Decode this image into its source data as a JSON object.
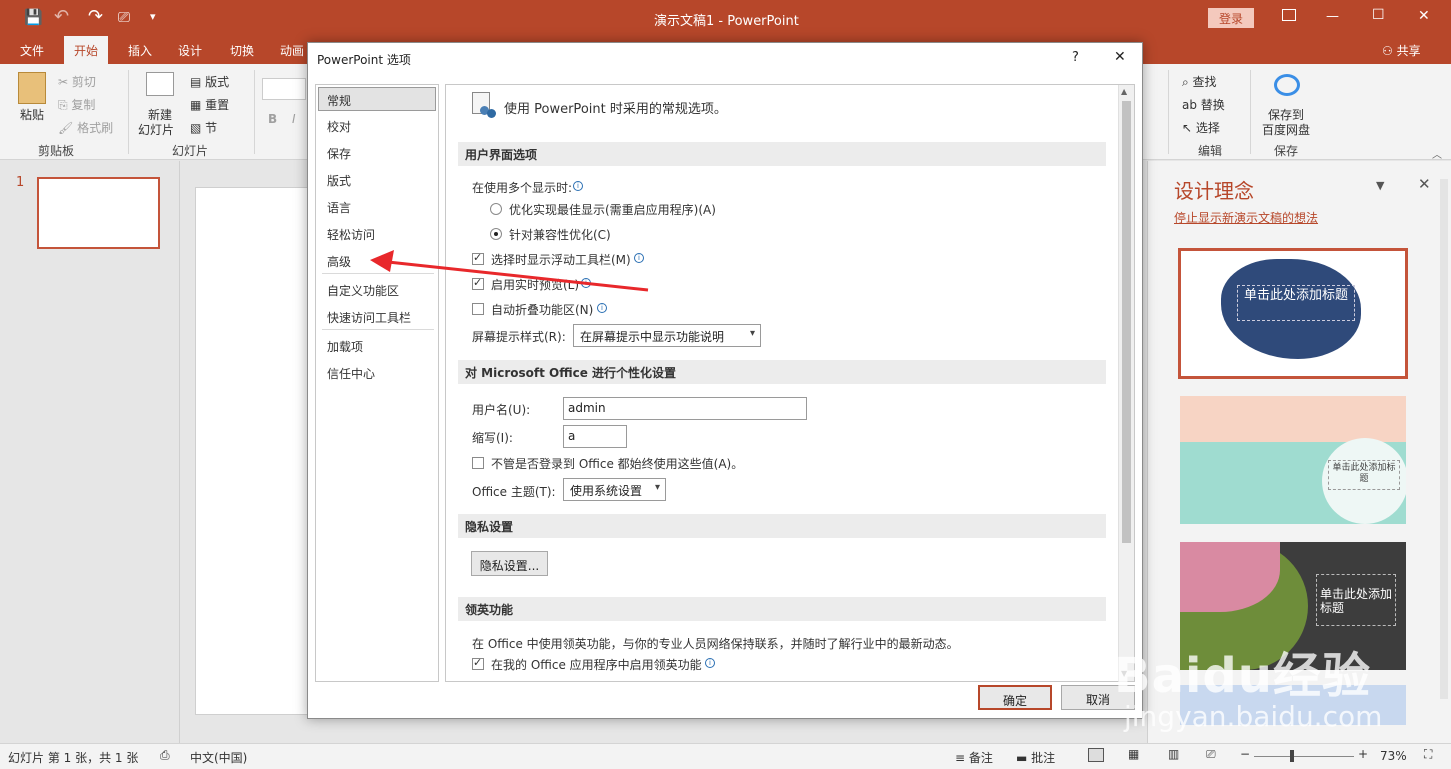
{
  "titlebar": {
    "doc_title": "演示文稿1 - PowerPoint",
    "login": "登录",
    "min_glyph": "—",
    "restore_glyph": "☐",
    "max_glyph": "☐",
    "close_glyph": "✕",
    "qat": {
      "save": "💾",
      "undo": "↶",
      "redo": "↷",
      "present": "⎚",
      "more": "▾"
    }
  },
  "ribbon_tabs": {
    "file": "文件",
    "home": "开始",
    "insert": "插入",
    "design": "设计",
    "transitions": "切换",
    "animations": "动画",
    "share": "共享"
  },
  "ribbon": {
    "paste": "粘贴",
    "cut": "剪切",
    "copy": "复制",
    "format_painter": "格式刷",
    "clipboard": "剪贴板",
    "new_slide_line1": "新建",
    "new_slide_line2": "幻灯片",
    "layout": "版式",
    "reset": "重置",
    "section": "节",
    "slides": "幻灯片",
    "bold": "B",
    "italic": "I",
    "find": "查找",
    "replace": "替换",
    "select": "选择",
    "editing": "编辑",
    "save_baidu_line1": "保存到",
    "save_baidu_line2": "百度网盘",
    "save": "保存"
  },
  "thumbs": {
    "slide_number": "1"
  },
  "design_pane": {
    "title": "设计理念",
    "stop_link": "停止显示新演示文稿的想法",
    "idea1_title": "单击此处添加标题",
    "idea2_title": "单击此处添加标题",
    "idea3_title": "单击此处添加标题"
  },
  "dialog": {
    "title": "PowerPoint 选项",
    "help": "?",
    "close": "✕",
    "nav": [
      "常规",
      "校对",
      "保存",
      "版式",
      "语言",
      "轻松访问",
      "高级",
      "自定义功能区",
      "快速访问工具栏",
      "加载项",
      "信任中心"
    ],
    "header": "使用 PowerPoint 时采用的常规选项。",
    "ui_section": "用户界面选项",
    "multi_display": "在使用多个显示时:",
    "opt_best": "优化实现最佳显示(需重启应用程序)(A)",
    "opt_compat": "针对兼容性优化(C)",
    "mini_toolbar": "选择时显示浮动工具栏(M)",
    "live_preview": "启用实时预览(L)",
    "collapse_ribbon": "自动折叠功能区(N)",
    "screentip_label": "屏幕提示样式(R):",
    "screentip_value": "在屏幕提示中显示功能说明",
    "personalize_section": "对 Microsoft Office 进行个性化设置",
    "username_label": "用户名(U):",
    "username_value": "admin",
    "initials_label": "缩写(I):",
    "initials_value": "a",
    "always_use": "不管是否登录到 Office 都始终使用这些值(A)。",
    "theme_label": "Office 主题(T):",
    "theme_value": "使用系统设置",
    "privacy_section": "隐私设置",
    "privacy_button": "隐私设置...",
    "linkedin_section": "领英功能",
    "linkedin_desc": "在 Office 中使用领英功能，与你的专业人员网络保持联系，并随时了解行业中的最新动态。",
    "linkedin_enable": "在我的 Office 应用程序中启用领英功能",
    "ok": "确定",
    "cancel": "取消"
  },
  "statusbar": {
    "slide_info": "幻灯片 第 1 张，共 1 张",
    "language": "中文(中国)",
    "notes": "备注",
    "comments": "批注",
    "zoom": "73%",
    "minus": "−",
    "plus": "+"
  },
  "watermark": {
    "brand": "Baidu经验",
    "url": "jingyan.baidu.com"
  },
  "colors": {
    "accent": "#b7472a",
    "arrow": "#e8282b"
  }
}
